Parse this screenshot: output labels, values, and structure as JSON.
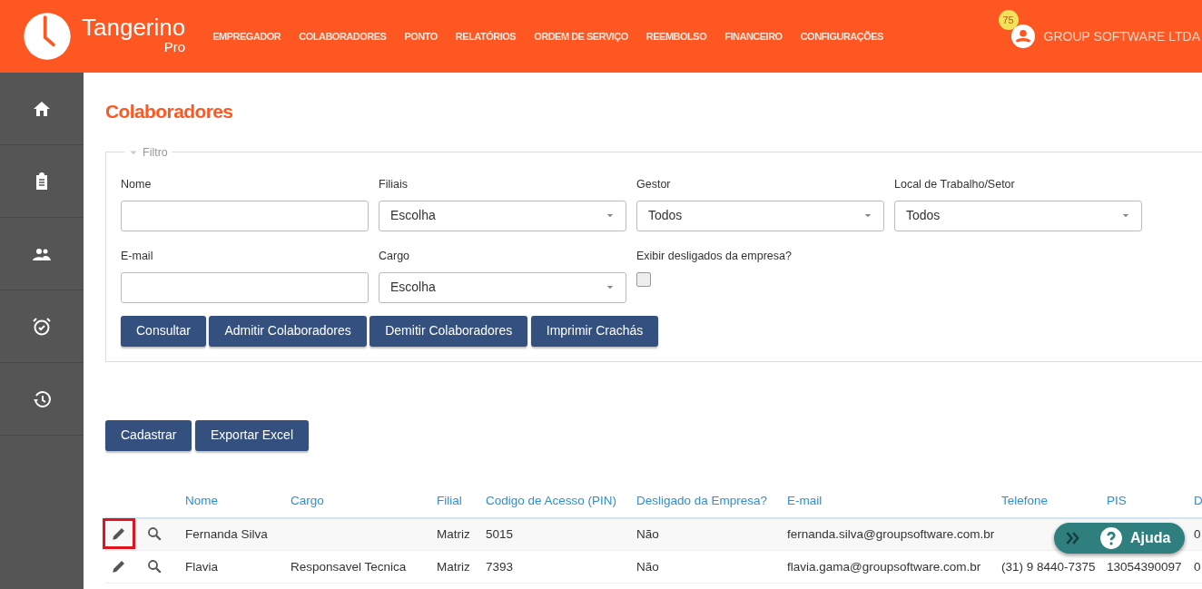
{
  "brand": {
    "name": "Tangerino",
    "sub": "Pro"
  },
  "nav": [
    {
      "label": "EMPREGADOR"
    },
    {
      "label": "COLABORADORES"
    },
    {
      "label": "PONTO"
    },
    {
      "label": "RELATÓRIOS"
    },
    {
      "label": "ORDEM DE SERVIÇO"
    },
    {
      "label": "REEMBOLSO"
    },
    {
      "label": "FINANCEIRO"
    },
    {
      "label": "CONFIGURAÇÕES"
    }
  ],
  "user": {
    "badge": "75",
    "company": "GROUP SOFTWARE LTDA"
  },
  "sidebar": [
    {
      "kind": "home"
    },
    {
      "kind": "clipboard"
    },
    {
      "kind": "people"
    },
    {
      "kind": "alarm"
    },
    {
      "kind": "history"
    }
  ],
  "page_title": "Colaboradores",
  "filter": {
    "legend": "Filtro",
    "expanded": true,
    "fields": [
      {
        "kind": "text",
        "label": "Nome"
      },
      {
        "kind": "select",
        "label": "Filiais",
        "value": "Escolha"
      },
      {
        "kind": "select",
        "label": "Gestor",
        "value": "Todos"
      },
      {
        "kind": "select",
        "label": "Local de Trabalho/Setor",
        "value": "Todos"
      },
      {
        "kind": "text",
        "label": "E-mail"
      },
      {
        "kind": "select",
        "label": "Cargo",
        "value": "Escolha"
      },
      {
        "kind": "checkbox",
        "label": "Exibir desligados da empresa?",
        "checked": false
      }
    ],
    "buttons": [
      "Consultar",
      "Admitir Colaboradores",
      "Demitir Colaboradores",
      "Imprimir Crachás"
    ]
  },
  "actions": [
    "Cadastrar",
    "Exportar Excel"
  ],
  "table": {
    "columns": [
      "Nome",
      "Cargo",
      "Filial",
      "Codigo de Acesso (PIN)",
      "Desligado da Empresa?",
      "E-mail",
      "Telefone",
      "PIS",
      "D"
    ],
    "rows": [
      {
        "highlighted": true,
        "cells": [
          "Fernanda Silva",
          "",
          "Matriz",
          "5015",
          "Não",
          "fernanda.silva@groupsoftware.com.br",
          "",
          "",
          "0"
        ]
      },
      {
        "highlighted": false,
        "cells": [
          "Flavia",
          "Responsavel Tecnica",
          "Matriz",
          "7393",
          "Não",
          "flavia.gama@groupsoftware.com.br",
          "(31) 9 8440-7375",
          "13054390097",
          "0"
        ]
      }
    ]
  },
  "help": {
    "label": "Ajuda"
  }
}
